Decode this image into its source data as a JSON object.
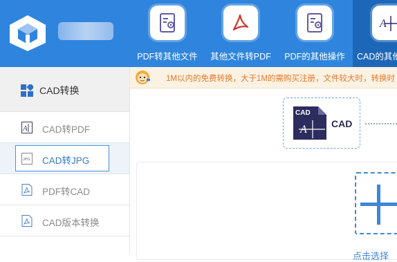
{
  "header": {
    "tools": [
      {
        "label": "PDF转其他文件",
        "icon": "settings-doc-icon"
      },
      {
        "label": "其他文件转PDF",
        "icon": "pdf-acrobat-icon"
      },
      {
        "label": "PDF的其他操作",
        "icon": "settings-doc-icon"
      },
      {
        "label": "CAD的其他",
        "icon": "cad-drawing-icon",
        "active": true
      }
    ],
    "brand_color": "#2f85dd"
  },
  "sidebar": {
    "heading": "CAD转换",
    "items": [
      {
        "label": "CAD转PDF",
        "icon": "cad-file-icon"
      },
      {
        "label": "CAD转JPG",
        "icon": "jpg-file-icon",
        "selected": true
      },
      {
        "label": "PDF转CAD",
        "icon": "pdf-file-icon"
      },
      {
        "label": "CAD版本转换",
        "icon": "pdf-file-icon"
      }
    ]
  },
  "notice": {
    "text": "1M以内的免费转换，大于1M的需购买注册，文件较大时，转换时"
  },
  "main": {
    "format_label": "CAD",
    "format_icon_label": "CAD",
    "upload_hint": "点击选择"
  },
  "colors": {
    "accent": "#3f86d8",
    "notice_text": "#e8792a"
  }
}
